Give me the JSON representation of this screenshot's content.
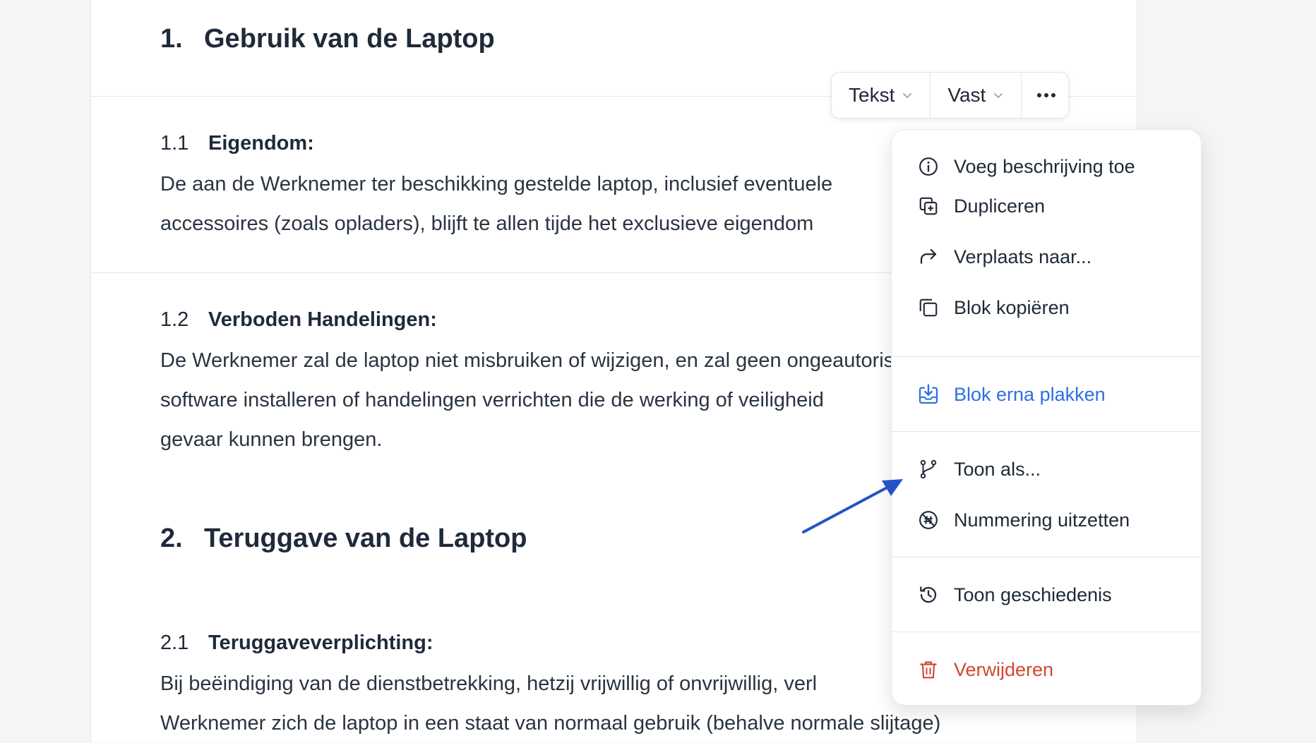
{
  "sections": [
    {
      "number": "1.",
      "title": "Gebruik van de Laptop",
      "subsections": [
        {
          "number": "1.1",
          "title": "Eigendom:",
          "lines": [
            "De aan de Werknemer ter beschikking gestelde laptop, inclusief eventuele",
            "accessoires (zoals opladers), blijft te allen tijde het exclusieve eigendom"
          ]
        },
        {
          "number": "1.2",
          "title": "Verboden Handelingen:",
          "lines": [
            "De Werknemer zal de laptop niet misbruiken of wijzigen, en zal geen ongeautoriseerde",
            "software installeren of handelingen verrichten die de werking of veiligheid",
            "gevaar kunnen brengen."
          ]
        }
      ]
    },
    {
      "number": "2.",
      "title": "Teruggave van de Laptop",
      "subsections": [
        {
          "number": "2.1",
          "title": "Teruggaveverplichting:",
          "lines": [
            "Bij beëindiging van de dienstbetrekking, hetzij vrijwillig of onvrijwillig, verl",
            "Werknemer zich de laptop in een staat van normaal gebruik (behalve normale slijtage)"
          ]
        }
      ]
    }
  ],
  "toolbar": {
    "type_label": "Tekst",
    "mode_label": "Vast",
    "more_icon": "ellipsis-icon"
  },
  "menu": {
    "items": [
      {
        "label": "Voeg beschrijving toe",
        "icon": "info-icon"
      },
      {
        "label": "Dupliceren",
        "icon": "duplicate-icon"
      },
      {
        "label": "Verplaats naar...",
        "icon": "forward-arrow-icon"
      },
      {
        "label": "Blok kopiëren",
        "icon": "copy-icon"
      },
      {
        "label": "Blok erna plakken",
        "icon": "paste-icon",
        "color": "#2f6fe4"
      },
      {
        "label": "Toon als...",
        "icon": "branch-icon"
      },
      {
        "label": "Nummering uitzetten",
        "icon": "numbering-off-icon"
      },
      {
        "label": "Toon geschiedenis",
        "icon": "history-icon"
      },
      {
        "label": "Verwijderen",
        "icon": "trash-icon",
        "color": "#d2462e"
      }
    ]
  },
  "annotation": {
    "arrow_color": "#2553c7"
  }
}
